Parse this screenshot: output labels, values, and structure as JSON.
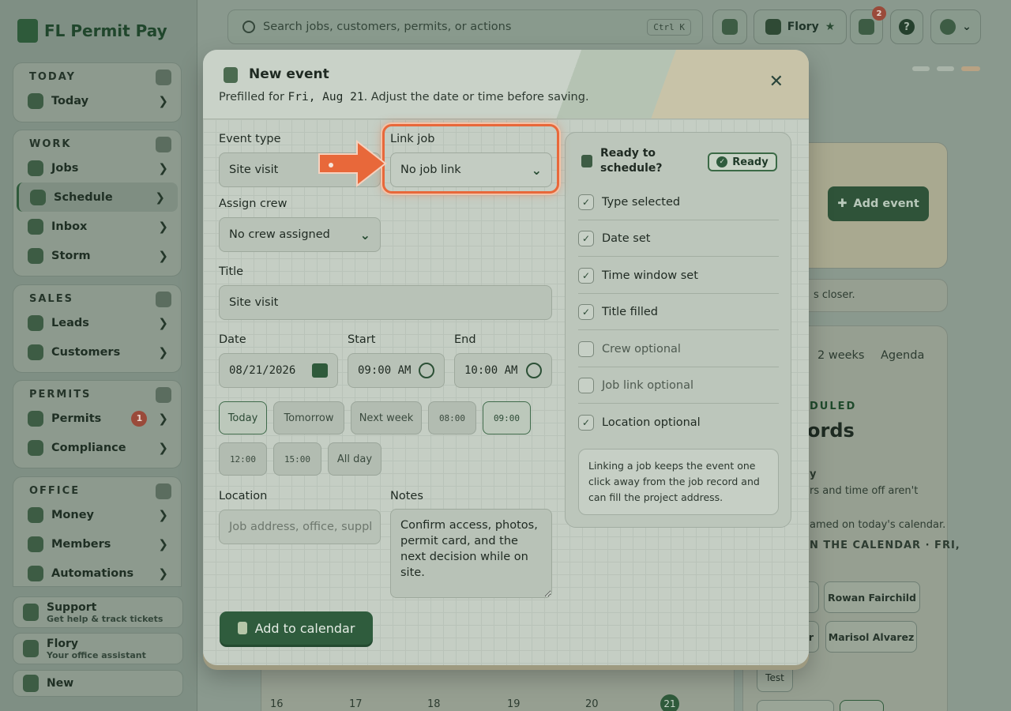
{
  "app": {
    "name": "FL Permit Pay"
  },
  "search": {
    "placeholder": "Search jobs, customers, permits, or actions",
    "shortcut": "Ctrl K"
  },
  "topbar": {
    "assistant_name": "Flory",
    "notifications_count": "2",
    "help_label": "?"
  },
  "sidebar": {
    "groups": [
      {
        "title": "TODAY",
        "items": [
          {
            "label": "Today"
          }
        ]
      },
      {
        "title": "WORK",
        "items": [
          {
            "label": "Jobs"
          },
          {
            "label": "Schedule"
          },
          {
            "label": "Inbox"
          },
          {
            "label": "Storm"
          }
        ]
      },
      {
        "title": "SALES",
        "items": [
          {
            "label": "Leads"
          },
          {
            "label": "Customers"
          }
        ]
      },
      {
        "title": "PERMITS",
        "items": [
          {
            "label": "Permits",
            "badge": "1"
          },
          {
            "label": "Compliance"
          }
        ]
      },
      {
        "title": "OFFICE",
        "items": [
          {
            "label": "Money"
          },
          {
            "label": "Members"
          },
          {
            "label": "Automations"
          }
        ]
      }
    ],
    "footer": {
      "support_title": "Support",
      "support_sub": "Get help & track tickets",
      "flory_title": "Flory",
      "flory_sub": "Your office assistant",
      "new_label": "New"
    }
  },
  "background": {
    "add_event": "Add event",
    "closer_text": "s closer.",
    "views": [
      "2 weeks",
      "Agenda"
    ],
    "scheduled_label": "DULED",
    "records_label": "ords",
    "side_text_1": "y",
    "side_text_2": "rs and time off aren't",
    "side_text_3": "amed on today's calendar.",
    "calendar_caption": "N THE CALENDAR · FRI,",
    "people": [
      "Rowan Fairchild",
      "Marisol Alvarez",
      "Test"
    ],
    "partial_chip_1": "r",
    "days": [
      "16",
      "17",
      "18",
      "19",
      "20",
      "21"
    ]
  },
  "modal": {
    "title": "New event",
    "subtitle_prefix": "Prefilled for ",
    "subtitle_date": "Fri, Aug 21",
    "subtitle_suffix": ". Adjust the date or time before saving.",
    "close_label": "✕",
    "event_type": {
      "label": "Event type",
      "value": "Site visit"
    },
    "link_job": {
      "label": "Link job",
      "value": "No job link"
    },
    "assign_crew": {
      "label": "Assign crew",
      "value": "No crew assigned"
    },
    "title_field": {
      "label": "Title",
      "value": "Site visit"
    },
    "date": {
      "label": "Date",
      "value": "08/21/2026"
    },
    "start": {
      "label": "Start",
      "value": "09:00 AM"
    },
    "end": {
      "label": "End",
      "value": "10:00 AM"
    },
    "quick_days": [
      "Today",
      "Tomorrow",
      "Next week"
    ],
    "quick_times": [
      "08:00",
      "09:00",
      "12:00",
      "15:00"
    ],
    "all_day": "All day",
    "location": {
      "label": "Location",
      "placeholder": "Job address, office, suppl"
    },
    "notes": {
      "label": "Notes",
      "value": "Confirm access, photos, permit card, and the next decision while on site."
    },
    "submit": "Add to calendar",
    "readiness": {
      "title": "Ready to schedule?",
      "status": "Ready",
      "checks": [
        {
          "label": "Type selected",
          "checked": true
        },
        {
          "label": "Date set",
          "checked": true
        },
        {
          "label": "Time window set",
          "checked": true
        },
        {
          "label": "Title filled",
          "checked": true
        },
        {
          "label": "Crew optional",
          "checked": false
        },
        {
          "label": "Job link optional",
          "checked": false
        },
        {
          "label": "Location optional",
          "checked": true
        }
      ],
      "note": "Linking a job keeps the event one click away from the job record and can fill the project address."
    }
  },
  "colors": {
    "brand": "#2f5c3d",
    "highlight": "#e8683a"
  }
}
